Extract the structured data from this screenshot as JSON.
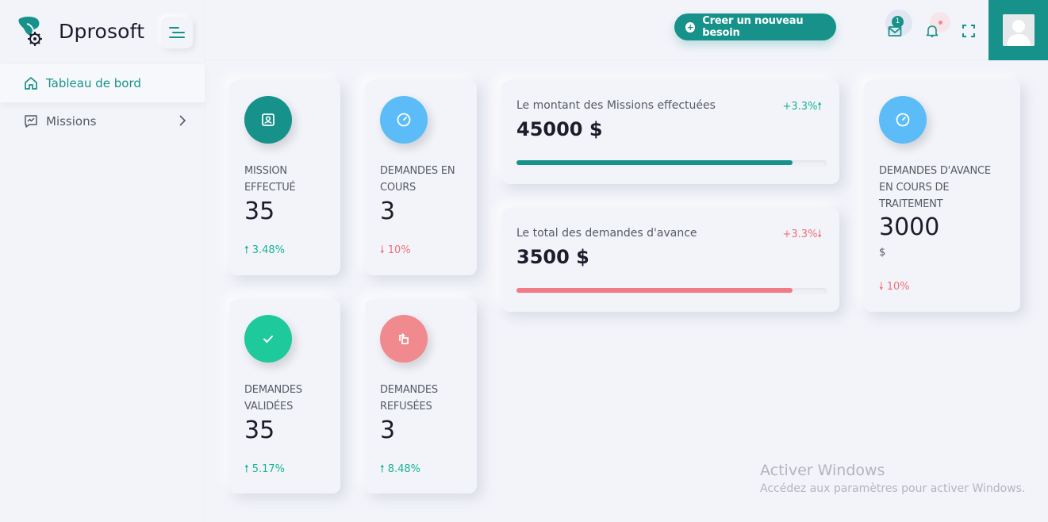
{
  "brand": {
    "name": "Dprosoft"
  },
  "sidebar": {
    "items": [
      {
        "label": "Tableau de bord",
        "icon": "home-icon"
      },
      {
        "label": "Missions",
        "icon": "chart-icon"
      }
    ]
  },
  "topbar": {
    "new_button_label": "Creer un nouveau besoin",
    "mail_badge": "1"
  },
  "stats": [
    {
      "label": "MISSION EFFECTUÉ",
      "value": "35",
      "trend": "3.48%",
      "direction": "up",
      "color": "#16928a",
      "icon": "profile-icon"
    },
    {
      "label": "DEMANDES EN COURS",
      "value": "3",
      "trend": "10%",
      "direction": "down",
      "color": "#5bbcf7",
      "icon": "gauge-icon"
    },
    {
      "label": "DEMANDES VALIDÉES",
      "value": "35",
      "trend": "5.17%",
      "direction": "up",
      "color": "#1ec99c",
      "icon": "check-icon"
    },
    {
      "label": "DEMANDES REFUSÉES",
      "value": "3",
      "trend": "8.48%",
      "direction": "up",
      "color": "#f08a8f",
      "icon": "rotate-icon"
    }
  ],
  "amounts": [
    {
      "title": "Le montant des Missions effectuées",
      "pct": "+3.3%",
      "direction": "up",
      "value": "45000 $",
      "progress": 0.89,
      "color": "#16928a"
    },
    {
      "title": "Le total des demandes d'avance",
      "pct": "+3.3%",
      "direction": "down",
      "value": "3500 $",
      "progress": 0.89,
      "color": "#f07b84"
    }
  ],
  "advance": {
    "label": "DEMANDES D'AVANCE EN COURS DE TRAITEMENT",
    "value": "3000",
    "unit": "$",
    "trend": "10%",
    "direction": "down",
    "color": "#5bbcf7"
  },
  "watermark": {
    "title": "Activer Windows",
    "subtitle": "Accédez aux paramètres pour activer Windows."
  }
}
